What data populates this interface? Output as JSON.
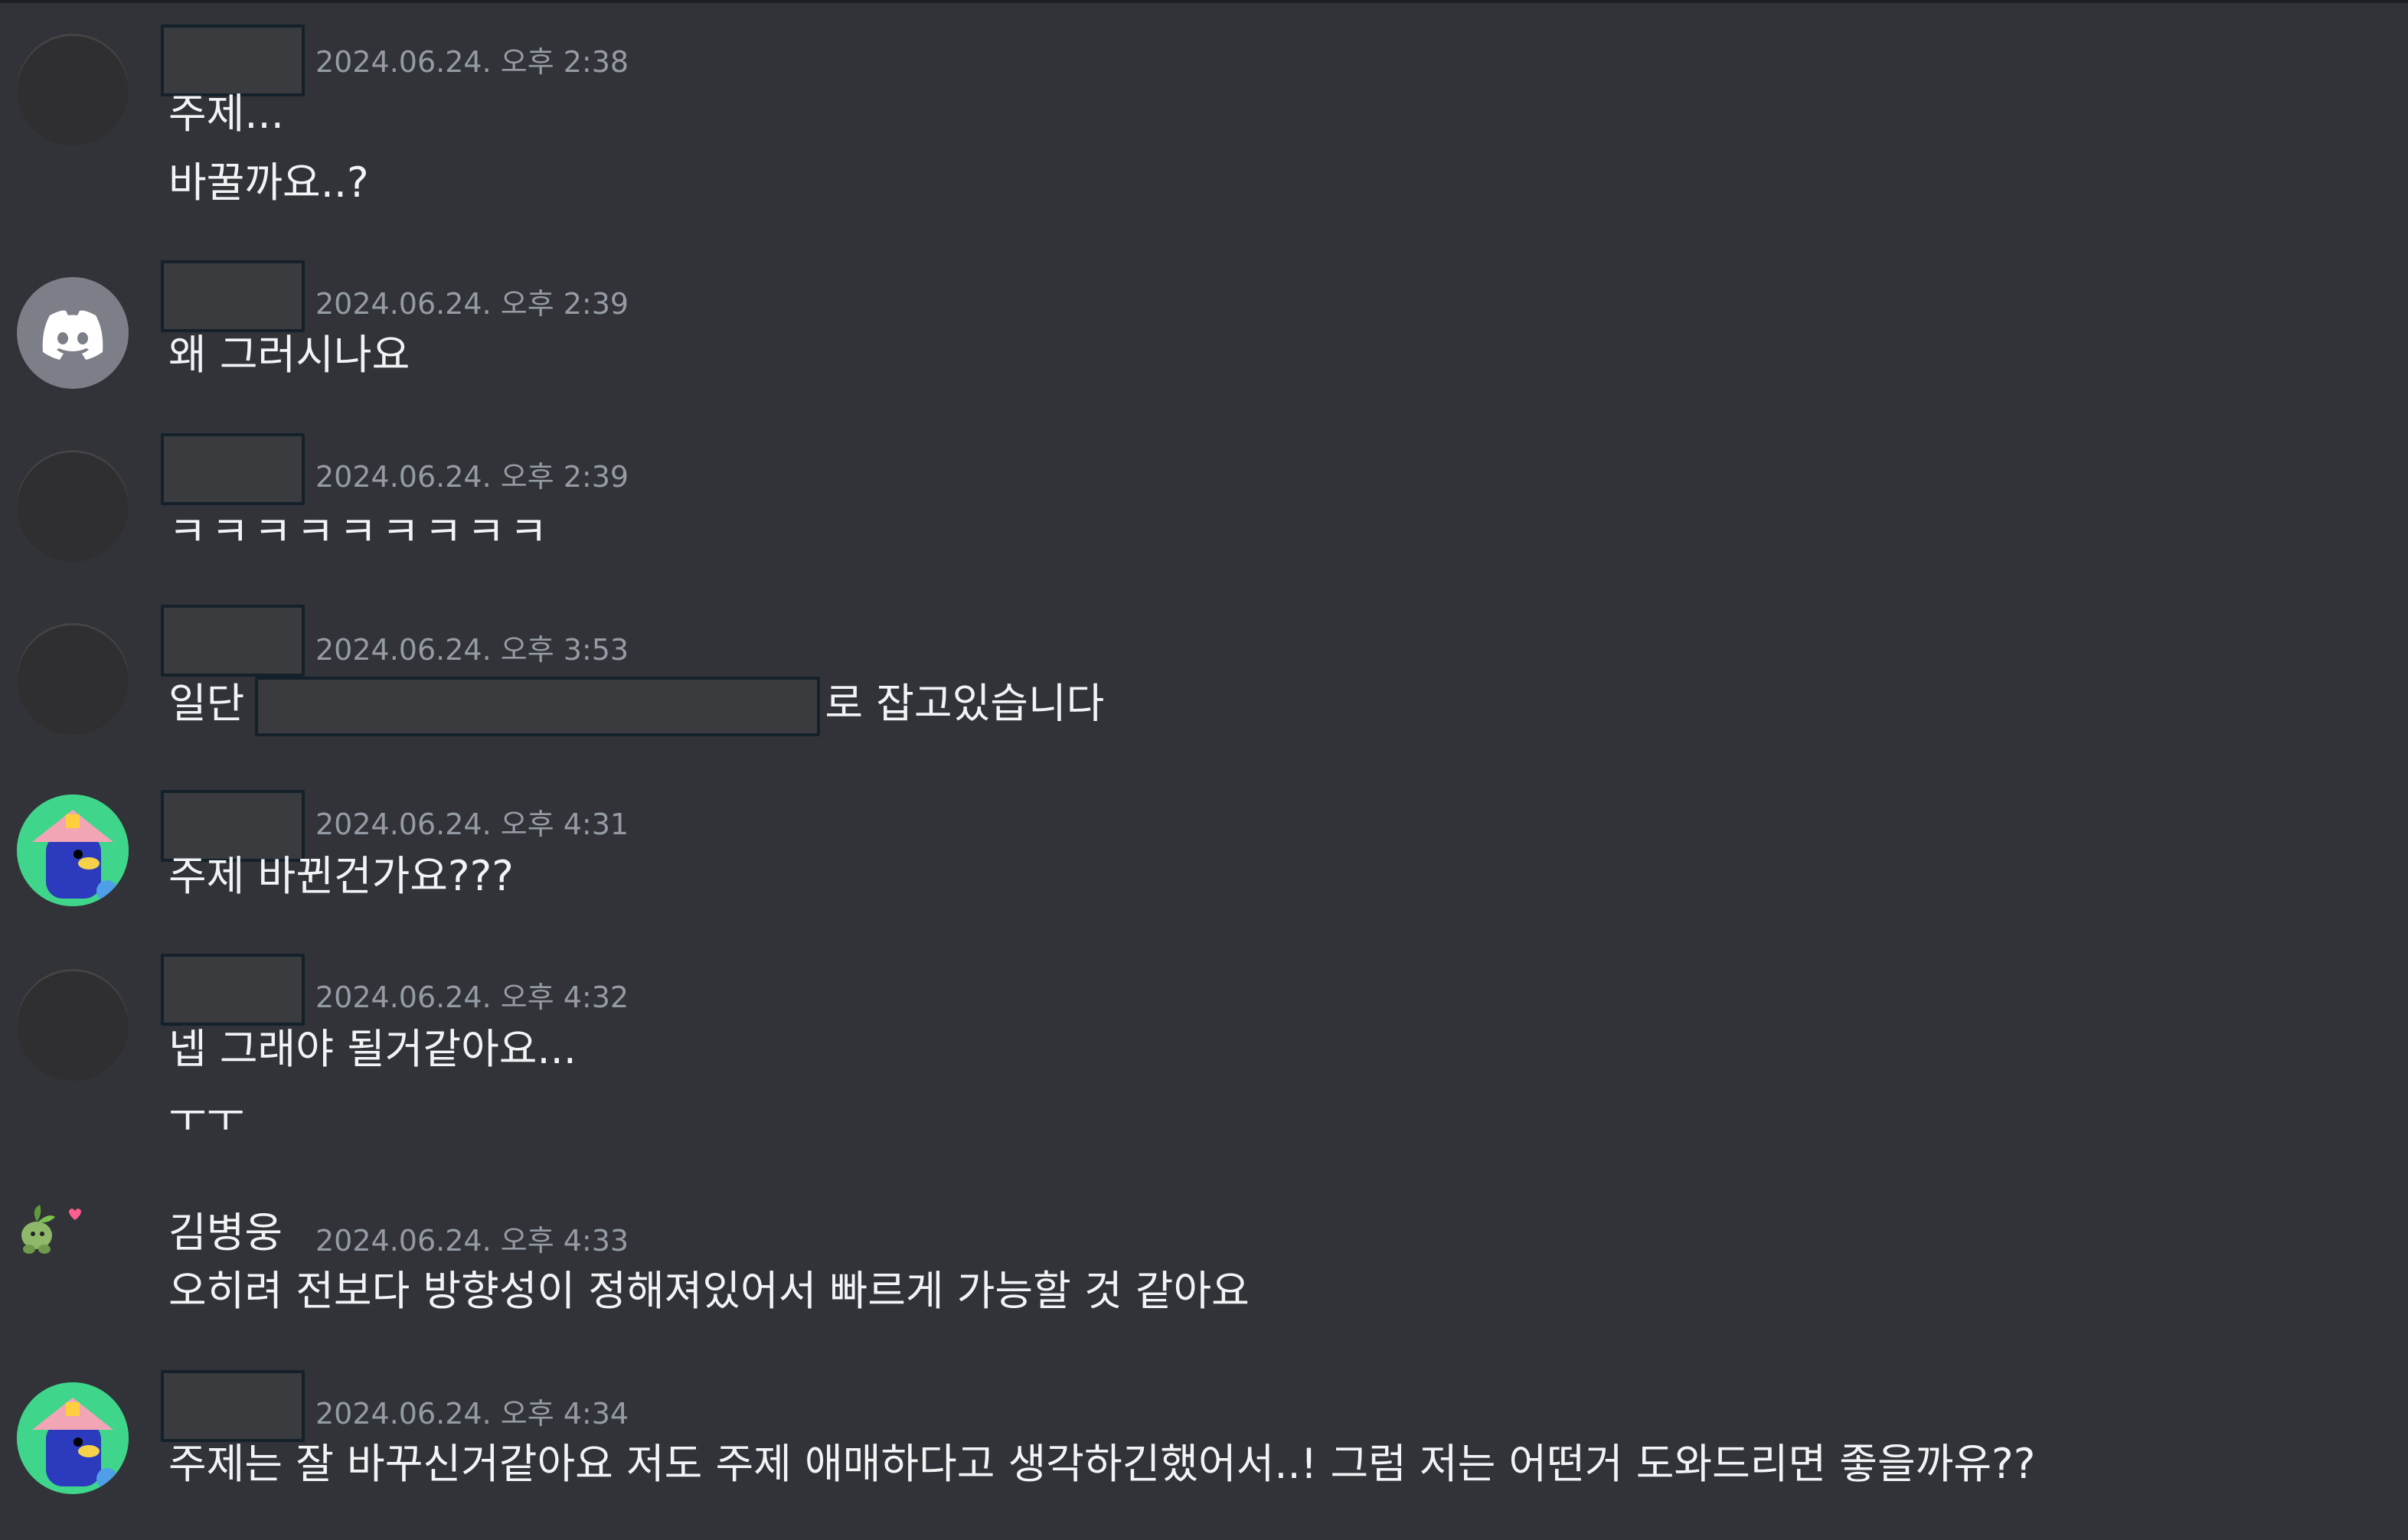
{
  "messages": [
    {
      "avatar": "default-dark-avatar",
      "author_hidden": true,
      "timestamp": "2024.06.24. 오후 2:38",
      "lines": [
        "주제...",
        "바꿀까요..?"
      ]
    },
    {
      "avatar": "discord-logo-avatar",
      "author_hidden": true,
      "timestamp": "2024.06.24. 오후 2:39",
      "lines": [
        "왜 그러시나요"
      ]
    },
    {
      "avatar": "default-dark-avatar",
      "author_hidden": true,
      "timestamp": "2024.06.24. 오후 2:39",
      "lines": [
        "ㅋㅋㅋㅋㅋㅋㅋㅋㅋ"
      ]
    },
    {
      "avatar": "default-dark-avatar",
      "author_hidden": true,
      "timestamp": "2024.06.24. 오후 3:53",
      "text_before": "일단",
      "text_after": "로 잡고있습니다"
    },
    {
      "avatar": "house-character-avatar",
      "author_hidden": true,
      "timestamp": "2024.06.24. 오후 4:31",
      "lines": [
        "주제 바뀐건가요???"
      ]
    },
    {
      "avatar": "default-dark-avatar",
      "author_hidden": true,
      "timestamp": "2024.06.24. 오후 4:32",
      "lines": [
        "넵 그래야 될거같아요...",
        "ㅜㅜ"
      ]
    },
    {
      "avatar": "sprout-sprite-avatar",
      "author": "김병웅",
      "timestamp": "2024.06.24. 오후 4:33",
      "lines": [
        "오히려 전보다 방향성이 정해져있어서 빠르게 가능할 것 같아요"
      ]
    },
    {
      "avatar": "house-character-avatar",
      "author_hidden": true,
      "timestamp": "2024.06.24. 오후 4:34",
      "lines": [
        "주제는 잘 바꾸신거같아요 저도 주제 애매하다고 생각하긴했어서..! 그럼 저는 어떤거 도와드리면 좋을까유??"
      ]
    }
  ],
  "colors": {
    "background": "#313338",
    "text": "#f2f3f5",
    "timestamp": "#949ba4",
    "redaction_fill": "#3a3b3e",
    "redaction_border": "#14212b"
  }
}
